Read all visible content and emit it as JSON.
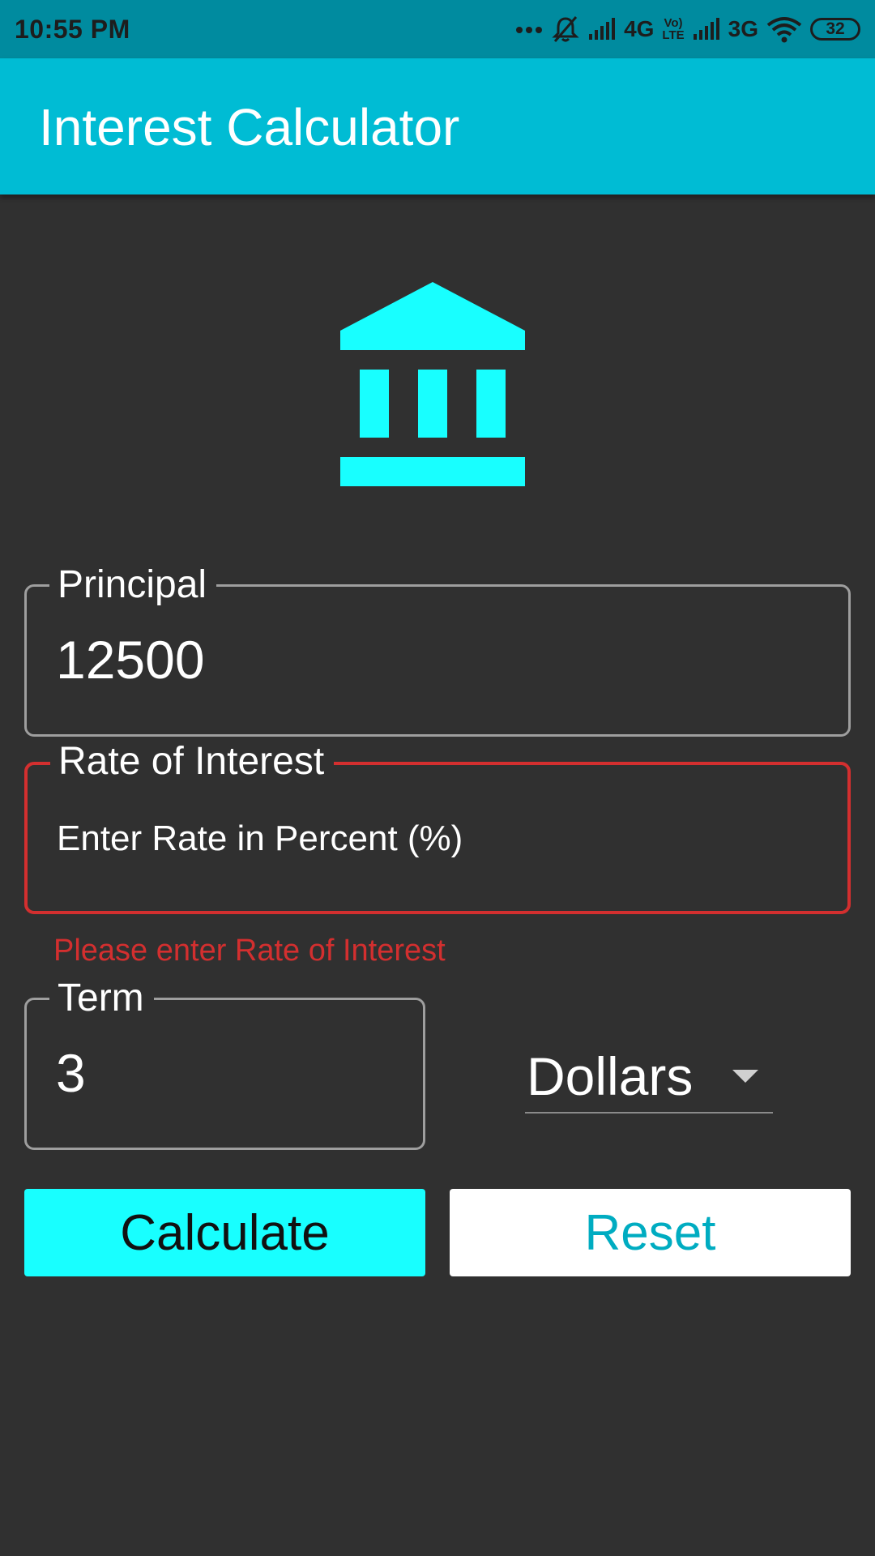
{
  "status_bar": {
    "time": "10:55 PM",
    "network_1": "4G",
    "volte": "Vo)\nLTE",
    "network_2": "3G",
    "battery": "32",
    "icons": [
      "more-dots-icon",
      "muted-bell-icon",
      "signal-icon",
      "signal-icon",
      "wifi-icon"
    ]
  },
  "app_bar": {
    "title": "Interest Calculator",
    "color": "#00bcd4"
  },
  "hero_icon": {
    "name": "bank-icon",
    "color": "#18ffff"
  },
  "form": {
    "principal": {
      "label": "Principal",
      "value": "12500"
    },
    "rate": {
      "label": "Rate of Interest",
      "placeholder": "Enter Rate in Percent (%)",
      "value": "",
      "error": "Please enter Rate of Interest",
      "error_color": "#d32f2f"
    },
    "term": {
      "label": "Term",
      "value": "3"
    },
    "currency": {
      "selected": "Dollars"
    }
  },
  "buttons": {
    "calculate": "Calculate",
    "reset": "Reset"
  }
}
